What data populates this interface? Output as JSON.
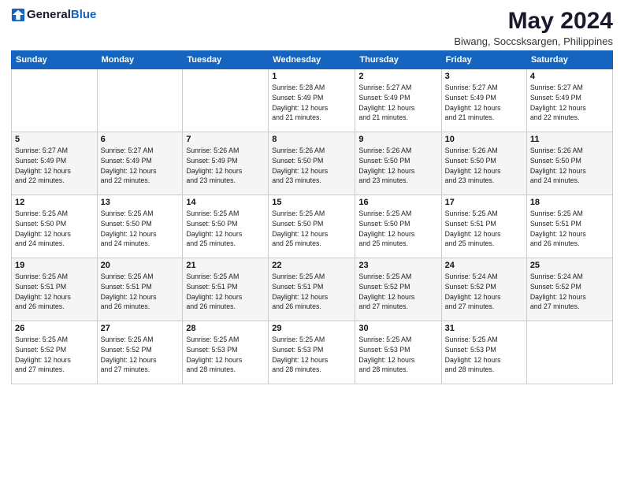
{
  "header": {
    "logo_general": "General",
    "logo_blue": "Blue",
    "month_title": "May 2024",
    "location": "Biwang, Soccsksargen, Philippines"
  },
  "days_of_week": [
    "Sunday",
    "Monday",
    "Tuesday",
    "Wednesday",
    "Thursday",
    "Friday",
    "Saturday"
  ],
  "weeks": [
    {
      "days": [
        {
          "number": "",
          "info": ""
        },
        {
          "number": "",
          "info": ""
        },
        {
          "number": "",
          "info": ""
        },
        {
          "number": "1",
          "info": "Sunrise: 5:28 AM\nSunset: 5:49 PM\nDaylight: 12 hours\nand 21 minutes."
        },
        {
          "number": "2",
          "info": "Sunrise: 5:27 AM\nSunset: 5:49 PM\nDaylight: 12 hours\nand 21 minutes."
        },
        {
          "number": "3",
          "info": "Sunrise: 5:27 AM\nSunset: 5:49 PM\nDaylight: 12 hours\nand 21 minutes."
        },
        {
          "number": "4",
          "info": "Sunrise: 5:27 AM\nSunset: 5:49 PM\nDaylight: 12 hours\nand 22 minutes."
        }
      ]
    },
    {
      "days": [
        {
          "number": "5",
          "info": "Sunrise: 5:27 AM\nSunset: 5:49 PM\nDaylight: 12 hours\nand 22 minutes."
        },
        {
          "number": "6",
          "info": "Sunrise: 5:27 AM\nSunset: 5:49 PM\nDaylight: 12 hours\nand 22 minutes."
        },
        {
          "number": "7",
          "info": "Sunrise: 5:26 AM\nSunset: 5:49 PM\nDaylight: 12 hours\nand 23 minutes."
        },
        {
          "number": "8",
          "info": "Sunrise: 5:26 AM\nSunset: 5:50 PM\nDaylight: 12 hours\nand 23 minutes."
        },
        {
          "number": "9",
          "info": "Sunrise: 5:26 AM\nSunset: 5:50 PM\nDaylight: 12 hours\nand 23 minutes."
        },
        {
          "number": "10",
          "info": "Sunrise: 5:26 AM\nSunset: 5:50 PM\nDaylight: 12 hours\nand 23 minutes."
        },
        {
          "number": "11",
          "info": "Sunrise: 5:26 AM\nSunset: 5:50 PM\nDaylight: 12 hours\nand 24 minutes."
        }
      ]
    },
    {
      "days": [
        {
          "number": "12",
          "info": "Sunrise: 5:25 AM\nSunset: 5:50 PM\nDaylight: 12 hours\nand 24 minutes."
        },
        {
          "number": "13",
          "info": "Sunrise: 5:25 AM\nSunset: 5:50 PM\nDaylight: 12 hours\nand 24 minutes."
        },
        {
          "number": "14",
          "info": "Sunrise: 5:25 AM\nSunset: 5:50 PM\nDaylight: 12 hours\nand 25 minutes."
        },
        {
          "number": "15",
          "info": "Sunrise: 5:25 AM\nSunset: 5:50 PM\nDaylight: 12 hours\nand 25 minutes."
        },
        {
          "number": "16",
          "info": "Sunrise: 5:25 AM\nSunset: 5:50 PM\nDaylight: 12 hours\nand 25 minutes."
        },
        {
          "number": "17",
          "info": "Sunrise: 5:25 AM\nSunset: 5:51 PM\nDaylight: 12 hours\nand 25 minutes."
        },
        {
          "number": "18",
          "info": "Sunrise: 5:25 AM\nSunset: 5:51 PM\nDaylight: 12 hours\nand 26 minutes."
        }
      ]
    },
    {
      "days": [
        {
          "number": "19",
          "info": "Sunrise: 5:25 AM\nSunset: 5:51 PM\nDaylight: 12 hours\nand 26 minutes."
        },
        {
          "number": "20",
          "info": "Sunrise: 5:25 AM\nSunset: 5:51 PM\nDaylight: 12 hours\nand 26 minutes."
        },
        {
          "number": "21",
          "info": "Sunrise: 5:25 AM\nSunset: 5:51 PM\nDaylight: 12 hours\nand 26 minutes."
        },
        {
          "number": "22",
          "info": "Sunrise: 5:25 AM\nSunset: 5:51 PM\nDaylight: 12 hours\nand 26 minutes."
        },
        {
          "number": "23",
          "info": "Sunrise: 5:25 AM\nSunset: 5:52 PM\nDaylight: 12 hours\nand 27 minutes."
        },
        {
          "number": "24",
          "info": "Sunrise: 5:24 AM\nSunset: 5:52 PM\nDaylight: 12 hours\nand 27 minutes."
        },
        {
          "number": "25",
          "info": "Sunrise: 5:24 AM\nSunset: 5:52 PM\nDaylight: 12 hours\nand 27 minutes."
        }
      ]
    },
    {
      "days": [
        {
          "number": "26",
          "info": "Sunrise: 5:25 AM\nSunset: 5:52 PM\nDaylight: 12 hours\nand 27 minutes."
        },
        {
          "number": "27",
          "info": "Sunrise: 5:25 AM\nSunset: 5:52 PM\nDaylight: 12 hours\nand 27 minutes."
        },
        {
          "number": "28",
          "info": "Sunrise: 5:25 AM\nSunset: 5:53 PM\nDaylight: 12 hours\nand 28 minutes."
        },
        {
          "number": "29",
          "info": "Sunrise: 5:25 AM\nSunset: 5:53 PM\nDaylight: 12 hours\nand 28 minutes."
        },
        {
          "number": "30",
          "info": "Sunrise: 5:25 AM\nSunset: 5:53 PM\nDaylight: 12 hours\nand 28 minutes."
        },
        {
          "number": "31",
          "info": "Sunrise: 5:25 AM\nSunset: 5:53 PM\nDaylight: 12 hours\nand 28 minutes."
        },
        {
          "number": "",
          "info": ""
        }
      ]
    }
  ]
}
